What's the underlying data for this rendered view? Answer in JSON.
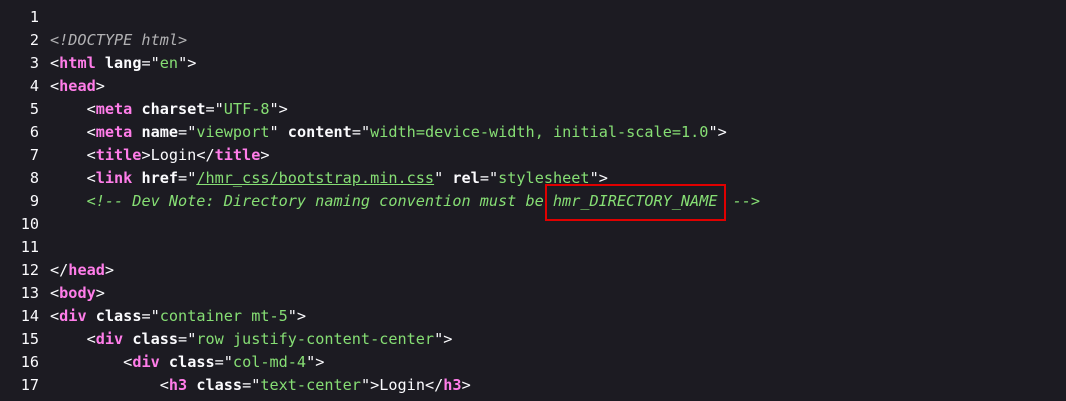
{
  "lines": [
    {
      "n": "1"
    },
    {
      "n": "2",
      "doctype": "<!DOCTYPE html>"
    },
    {
      "n": "3",
      "open": "<",
      "tag": "html",
      "attr1": "lang",
      "eq1": "=\"",
      "val1": "en",
      "close": "\">"
    },
    {
      "n": "4",
      "open": "<",
      "tag": "head",
      "close": ">"
    },
    {
      "n": "5",
      "indent": "    ",
      "open": "<",
      "tag": "meta",
      "attr1": "charset",
      "eq1": "=\"",
      "val1": "UTF-8",
      "close": "\">"
    },
    {
      "n": "6",
      "indent": "    ",
      "open": "<",
      "tag": "meta",
      "attr1": "name",
      "eq1": "=\"",
      "val1": "viewport",
      "mid": "\" ",
      "attr2": "content",
      "eq2": "=\"",
      "val2": "width=device-width, initial-scale=1.0",
      "close": "\">"
    },
    {
      "n": "7",
      "indent": "    ",
      "open": "<",
      "tag": "title",
      "close": ">",
      "text": "Login",
      "endopen": "</",
      "endtag": "title",
      "endclose": ">"
    },
    {
      "n": "8",
      "indent": "    ",
      "open": "<",
      "tag": "link",
      "attr1": "href",
      "eq1": "=\"",
      "val1": "/hmr_css/bootstrap.min.css",
      "mid": "\" ",
      "attr2": "rel",
      "eq2": "=\"",
      "val2": "stylesheet",
      "close": "\">"
    },
    {
      "n": "9",
      "indent": "    ",
      "comment_start": "<!-- Dev Note: Directory naming convention must be ",
      "comment_highlight": "hmr_DIRECTORY_NAME",
      "comment_end": " -->"
    },
    {
      "n": "10"
    },
    {
      "n": "11"
    },
    {
      "n": "12",
      "open": "</",
      "tag": "head",
      "close": ">"
    },
    {
      "n": "13",
      "open": "<",
      "tag": "body",
      "close": ">"
    },
    {
      "n": "14",
      "open": "<",
      "tag": "div",
      "attr1": "class",
      "eq1": "=\"",
      "val1": "container mt-5",
      "close": "\">"
    },
    {
      "n": "15",
      "indent": "    ",
      "open": "<",
      "tag": "div",
      "attr1": "class",
      "eq1": "=\"",
      "val1": "row justify-content-center",
      "close": "\">"
    },
    {
      "n": "16",
      "indent": "        ",
      "open": "<",
      "tag": "div",
      "attr1": "class",
      "eq1": "=\"",
      "val1": "col-md-4",
      "close": "\">"
    },
    {
      "n": "17",
      "indent": "            ",
      "open": "<",
      "tag": "h3",
      "attr1": "class",
      "eq1": "=\"",
      "val1": "text-center",
      "close": "\">",
      "text": "Login",
      "endopen": "</",
      "endtag": "h3",
      "endclose": ">"
    }
  ],
  "highlight_color": "#e00000"
}
